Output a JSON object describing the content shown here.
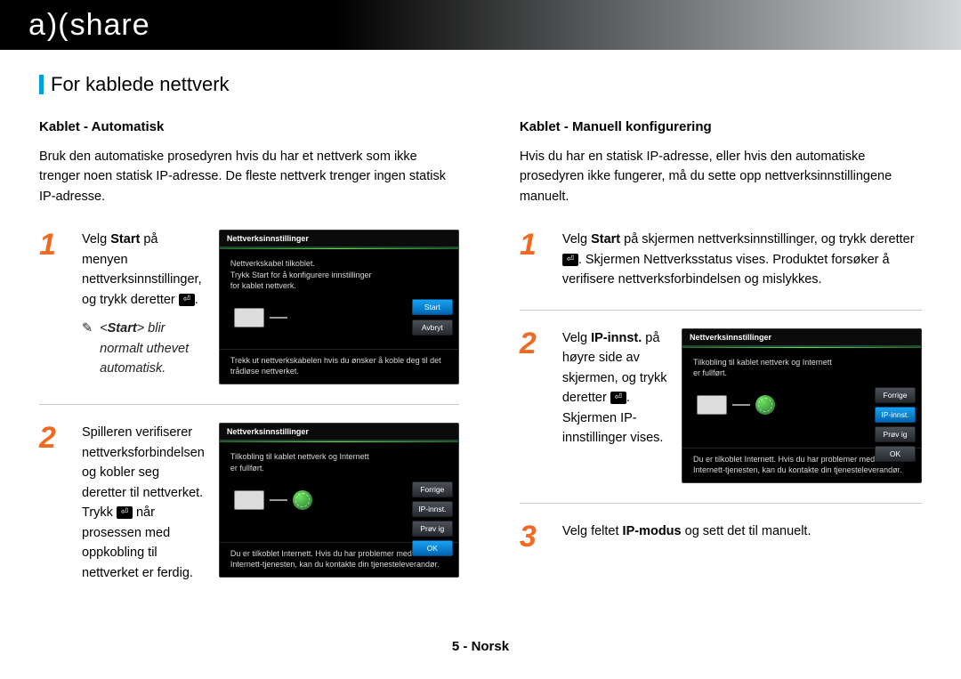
{
  "header": {
    "logo_left": "a",
    "logo_glyph": ")(",
    "logo_right": "share"
  },
  "section_title": "For kablede nettverk",
  "left": {
    "title": "Kablet - Automatisk",
    "intro": "Bruk den automatiske prosedyren hvis du har et nettverk som ikke trenger noen statisk IP-adresse. De fleste nettverk trenger ingen statisk IP-adresse.",
    "step1": {
      "num": "1",
      "text_pre": "Velg ",
      "text_bold": "Start",
      "text_post": " på menyen nettverksinnstillinger, og trykk deretter ",
      "text_end": ".",
      "hint_prefix": "✎",
      "hint_pre": "<",
      "hint_bold": "Start",
      "hint_post": "> blir normalt uthevet automatisk.",
      "screenshot": {
        "title": "Nettverksinnstillinger",
        "msg1": "Nettverkskabel tilkoblet.",
        "msg2": "Trykk Start for å konfigurere innstillinger for kablet nettverk.",
        "lowmsg": "Trekk ut nettverkskabelen hvis du ønsker å koble deg til det trådløse nettverket.",
        "btn_start": "Start",
        "btn_avbryt": "Avbryt"
      }
    },
    "step2": {
      "num": "2",
      "text": "Spilleren verifiserer nettverksforbindelsen og kobler seg deretter til nettverket.",
      "text2_pre": "Trykk ",
      "text2_post": " når prosessen med oppkobling til nettverket er ferdig.",
      "screenshot": {
        "title": "Nettverksinnstillinger",
        "msg1": "Tilkobling til kablet nettverk og Internett er fullført.",
        "lowmsg": "Du er tilkoblet Internett. Hvis du har problemer med å bruke Internett-tjenesten, kan du kontakte din tjenesteleverandør.",
        "btn_forrige": "Forrige",
        "btn_ip": "IP-innst.",
        "btn_prov": "Prøv ig",
        "btn_ok": "OK"
      }
    }
  },
  "right": {
    "title": "Kablet - Manuell konfigurering",
    "intro": "Hvis du har en statisk IP-adresse, eller hvis den automatiske prosedyren ikke fungerer, må du sette opp nettverksinnstillingene manuelt.",
    "step1": {
      "num": "1",
      "text_pre": "Velg ",
      "text_bold": "Start",
      "text_post": " på skjermen nettverksinnstillinger, og trykk deretter ",
      "text_end": ". Skjermen Nettverksstatus vises. Produktet forsøker å verifisere nettverksforbindelsen og mislykkes."
    },
    "step2": {
      "num": "2",
      "text_pre": "Velg ",
      "text_bold": "IP-innst.",
      "text_post": " på høyre side av skjermen, og trykk deretter ",
      "text_end": ". Skjermen IP-innstillinger vises.",
      "screenshot": {
        "title": "Nettverksinnstillinger",
        "msg1": "Tilkobling til kablet nettverk og Internett er fullført.",
        "lowmsg": "Du er tilkoblet Internett. Hvis du har problemer med å bruke Internett-tjenesten, kan du kontakte din tjenesteleverandør.",
        "btn_forrige": "Forrige",
        "btn_ip": "IP-innst.",
        "btn_prov": "Prøv ig",
        "btn_ok": "OK"
      }
    },
    "step3": {
      "num": "3",
      "text_pre": "Velg feltet ",
      "text_bold": "IP-modus",
      "text_post": " og sett det til manuelt."
    }
  },
  "footer": "5 - Norsk"
}
